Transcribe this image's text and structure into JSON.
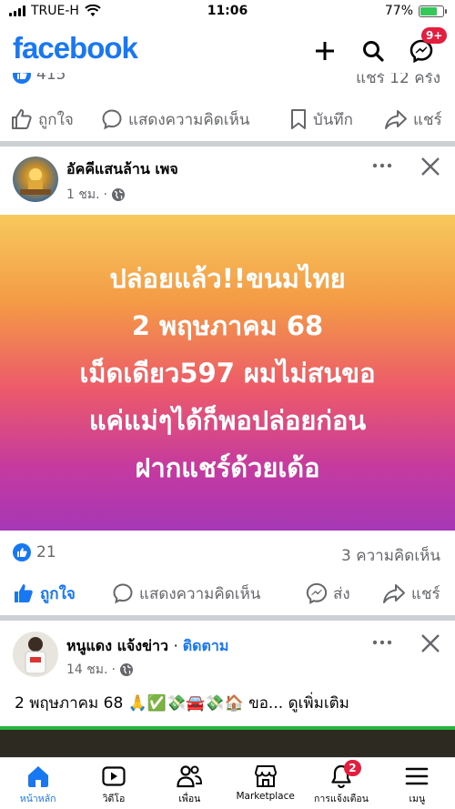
{
  "status_bar": {
    "carrier": "TRUE-H",
    "time": "11:06",
    "battery": "77%",
    "battery_level": 0.77
  },
  "header": {
    "logo": "facebook",
    "messenger_badge": "9+"
  },
  "prev_post": {
    "like_count": "415",
    "share_count": "แชร์ 12 ครั้ง"
  },
  "actions": {
    "like": "ถูกใจ",
    "comment": "แสดงความคิดเห็น",
    "save": "บันทึก",
    "share": "แชร์",
    "send": "ส่ง"
  },
  "post1": {
    "page_name": "อัคคีแสนล้าน เพจ",
    "time": "1 ชม.",
    "lines": [
      "ปล่อยแล้ว!!ขนมไทย",
      "2 พฤษภาคม 68",
      "เม็ดเดียว597 ผมไม่สนขอ",
      "แค่แม่ๆได้ก็พอปล่อยก่อน",
      "ฝากแชร์ด้วยเด้อ"
    ],
    "reaction_count": "21",
    "comment_count": "3 ความคิดเห็น"
  },
  "post2": {
    "page_name": "หนูแดง แจ้งข่าว",
    "follow": "ติดตาม",
    "time": "14 ชม.",
    "text": "2 พฤษภาคม 68 🙏✅💸🚘💸🏠 ขอ...",
    "see_more": "ดูเพิ่มเติม"
  },
  "tabs": [
    {
      "label": "หน้าหลัก",
      "icon": "home-icon"
    },
    {
      "label": "วิดีโอ",
      "icon": "video-icon"
    },
    {
      "label": "เพื่อน",
      "icon": "friends-icon"
    },
    {
      "label": "Marketplace",
      "icon": "marketplace-icon"
    },
    {
      "label": "การแจ้งเตือน",
      "icon": "bell-icon",
      "badge": "2"
    },
    {
      "label": "เมนู",
      "icon": "menu-icon"
    }
  ],
  "colors": {
    "brand": "#1877f2",
    "badge": "#e41e3f",
    "muted": "#65676b"
  }
}
